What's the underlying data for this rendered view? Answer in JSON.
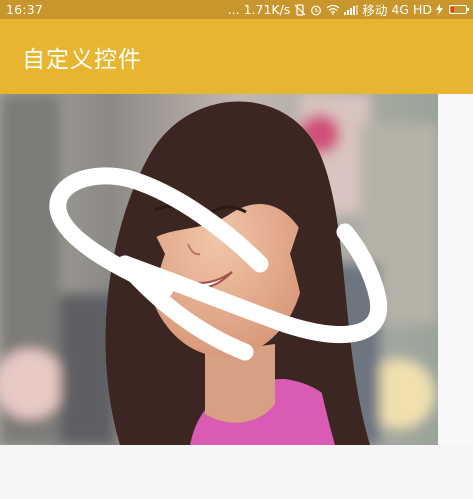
{
  "status_bar": {
    "time": "16:37",
    "dots": "...",
    "net_speed": "1.71K/s",
    "carrier": "移动",
    "network": "4G HD",
    "icons": [
      "vibrate-off-icon",
      "alarm-icon",
      "wifi-icon",
      "signal-icon",
      "charging-icon",
      "battery-icon"
    ]
  },
  "toolbar": {
    "title": "自定义控件",
    "color": "#e8b530"
  },
  "canvas": {
    "stroke_color": "#ffffff",
    "image_subject": "photo-of-smiling-woman"
  }
}
